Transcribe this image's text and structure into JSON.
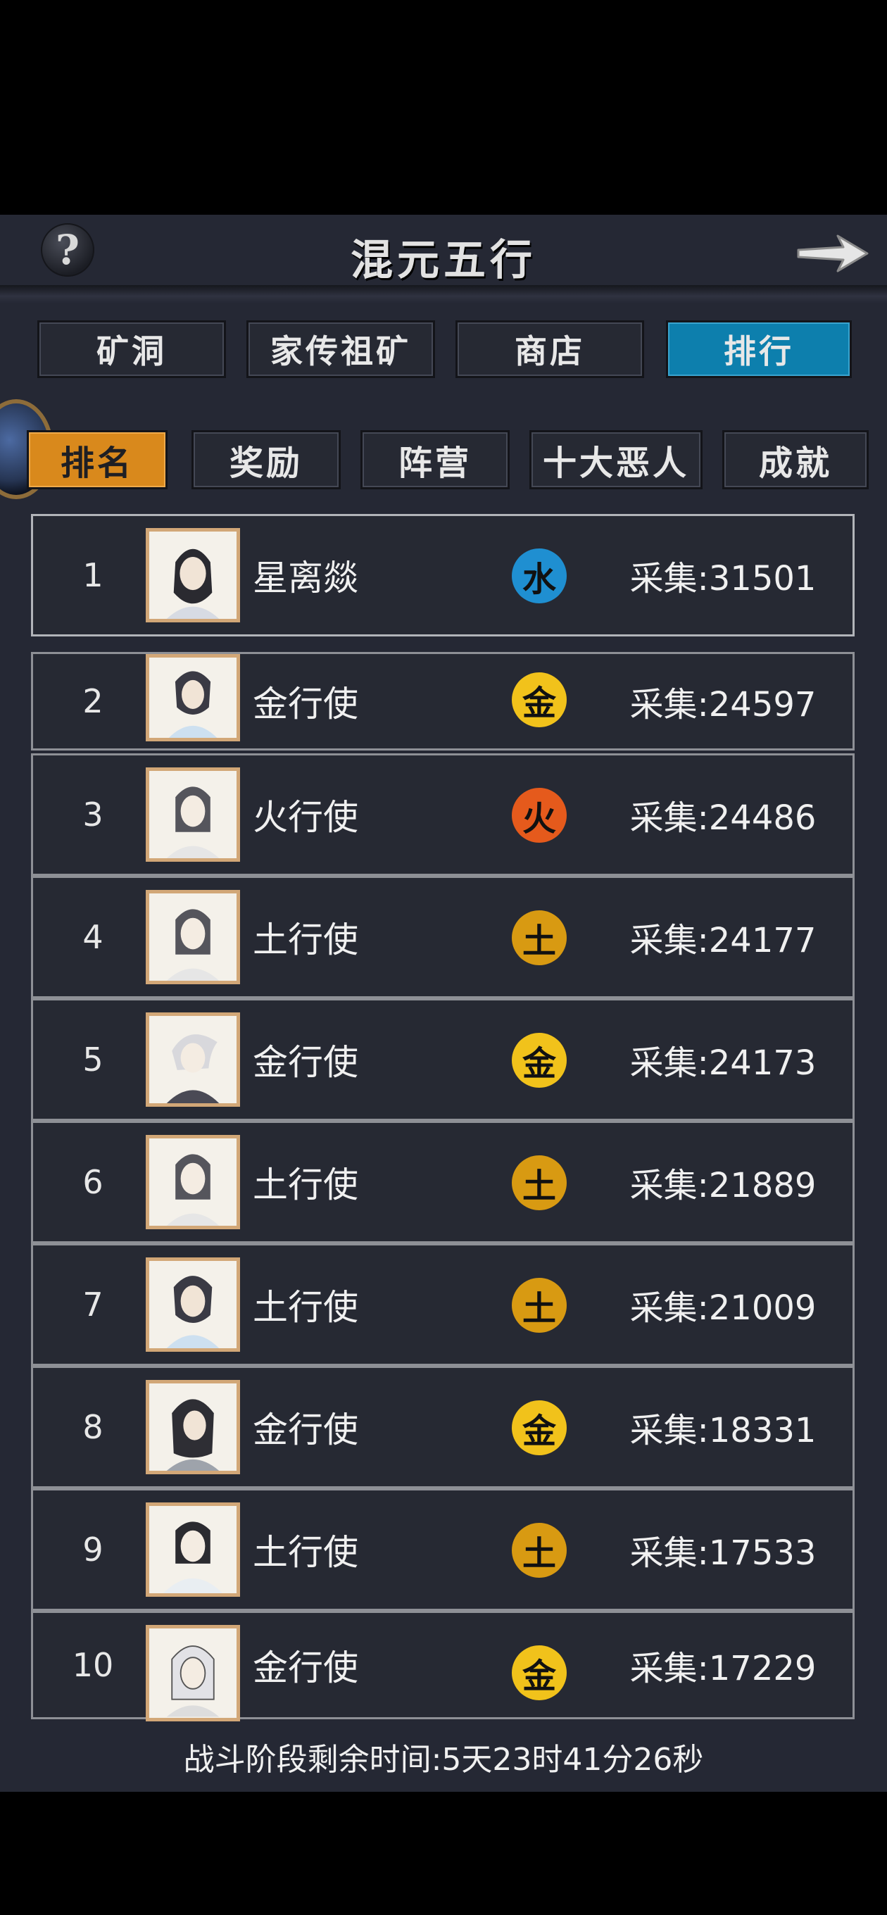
{
  "header": {
    "title": "混元五行",
    "help_label": "?"
  },
  "top_tabs": [
    {
      "label": "矿洞",
      "active": false
    },
    {
      "label": "家传祖矿",
      "active": false
    },
    {
      "label": "商店",
      "active": false
    },
    {
      "label": "排行",
      "active": true
    }
  ],
  "sub_tabs": [
    {
      "label": "排名",
      "active": true
    },
    {
      "label": "奖励",
      "active": false
    },
    {
      "label": "阵营",
      "active": false
    },
    {
      "label": "十大恶人",
      "active": false
    },
    {
      "label": "成就",
      "active": false
    }
  ],
  "colors": {
    "water": "#1f8fd1",
    "metal": "#f1c21b",
    "fire": "#e55a1c",
    "earth": "#d89a12"
  },
  "rankings": [
    {
      "rank": "1",
      "name": "星离燚",
      "element": "水",
      "element_type": "water",
      "score": "采集:31501"
    },
    {
      "rank": "2",
      "name": "金行使",
      "element": "金",
      "element_type": "metal",
      "score": "采集:24597"
    },
    {
      "rank": "3",
      "name": "火行使",
      "element": "火",
      "element_type": "fire",
      "score": "采集:24486"
    },
    {
      "rank": "4",
      "name": "土行使",
      "element": "土",
      "element_type": "earth",
      "score": "采集:24177"
    },
    {
      "rank": "5",
      "name": "金行使",
      "element": "金",
      "element_type": "metal",
      "score": "采集:24173"
    },
    {
      "rank": "6",
      "name": "土行使",
      "element": "土",
      "element_type": "earth",
      "score": "采集:21889"
    },
    {
      "rank": "7",
      "name": "土行使",
      "element": "土",
      "element_type": "earth",
      "score": "采集:21009"
    },
    {
      "rank": "8",
      "name": "金行使",
      "element": "金",
      "element_type": "metal",
      "score": "采集:18331"
    },
    {
      "rank": "9",
      "name": "土行使",
      "element": "土",
      "element_type": "earth",
      "score": "采集:17533"
    },
    {
      "rank": "10",
      "name": "金行使",
      "element": "金",
      "element_type": "metal",
      "score": "采集:17229"
    }
  ],
  "footer": {
    "countdown": "战斗阶段剩余时间:5天23时41分26秒"
  }
}
